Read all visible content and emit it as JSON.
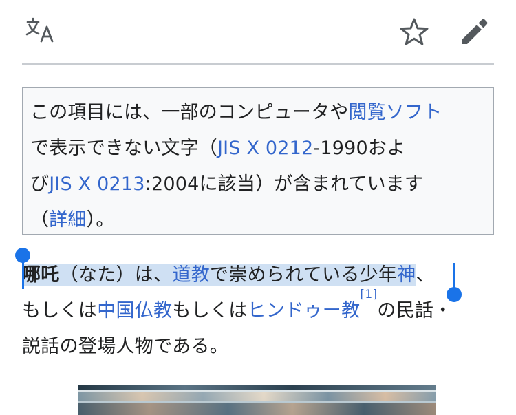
{
  "toolbar": {
    "language_icon": "translate-icon",
    "watch_icon": "star-icon",
    "edit_icon": "pencil-icon"
  },
  "notice": {
    "text1": "この項目には、一部のコンピュータや",
    "link_browser": "閲覧ソフト",
    "text2": "で表示できない文字（",
    "link_jis0212": "JIS X 0212",
    "text3": "-1990およ",
    "text3b": "び",
    "link_jis0213": "JIS X 0213",
    "text4": ":2004に該当）が含まれています",
    "text5": "（",
    "link_details": "詳細",
    "text6": "）。"
  },
  "article": {
    "title_bold": "哪吒",
    "reading": "（なた）は、",
    "link_taoism": "道教",
    "text_a": "で崇められている少年",
    "link_god": "神",
    "text_b": "、",
    "text_c": "もしくは",
    "link_chinese_buddhism": "中国仏教",
    "text_d": "もしくは",
    "link_hinduism": "ヒンドゥー教",
    "ref": "[1]",
    "text_e": "の民話・",
    "text_f": "説話の登場人物である。"
  },
  "colors": {
    "link": "#3366cc",
    "selection": "#cfe0f3",
    "handle": "#1a73e8",
    "notice_bg": "#f8f9fa",
    "notice_border": "#a2a9b1"
  }
}
